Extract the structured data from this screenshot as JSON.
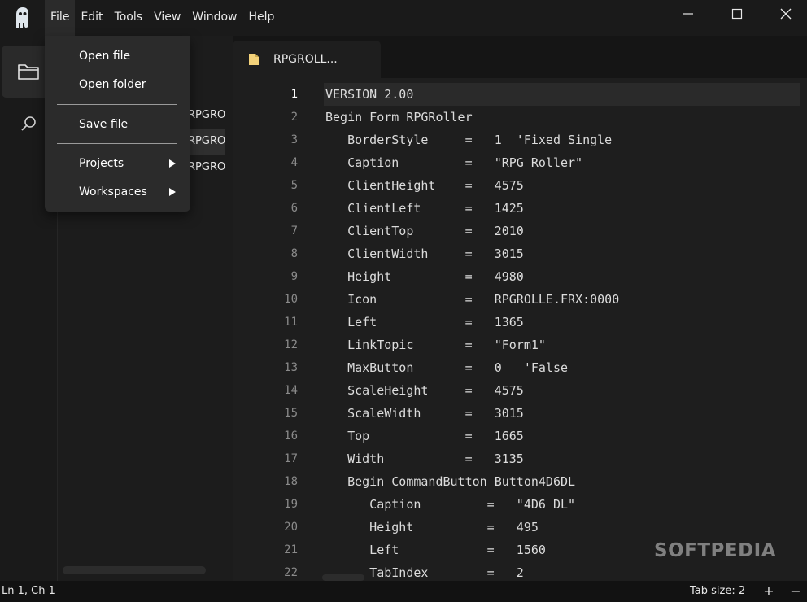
{
  "menubar": {
    "items": [
      {
        "label": "File"
      },
      {
        "label": "Edit"
      },
      {
        "label": "Tools"
      },
      {
        "label": "View"
      },
      {
        "label": "Window"
      },
      {
        "label": "Help"
      }
    ]
  },
  "file_menu": {
    "open_file": "Open file",
    "open_folder": "Open folder",
    "save_file": "Save file",
    "projects": "Projects",
    "workspaces": "Workspaces"
  },
  "explorer": {
    "files": [
      {
        "label": "RPGROLLER.MAK"
      },
      {
        "label": "RPGROLLE.FRM"
      },
      {
        "label": "RPGROLLE.FRX"
      }
    ]
  },
  "editor": {
    "tab_label": "RPGROLL...",
    "lines": [
      {
        "num": "1",
        "text": "VERSION 2.00"
      },
      {
        "num": "2",
        "text": "Begin Form RPGRoller"
      },
      {
        "num": "3",
        "text": "   BorderStyle     =   1  'Fixed Single"
      },
      {
        "num": "4",
        "text": "   Caption         =   \"RPG Roller\""
      },
      {
        "num": "5",
        "text": "   ClientHeight    =   4575"
      },
      {
        "num": "6",
        "text": "   ClientLeft      =   1425"
      },
      {
        "num": "7",
        "text": "   ClientTop       =   2010"
      },
      {
        "num": "8",
        "text": "   ClientWidth     =   3015"
      },
      {
        "num": "9",
        "text": "   Height          =   4980"
      },
      {
        "num": "10",
        "text": "   Icon            =   RPGROLLE.FRX:0000"
      },
      {
        "num": "11",
        "text": "   Left            =   1365"
      },
      {
        "num": "12",
        "text": "   LinkTopic       =   \"Form1\""
      },
      {
        "num": "13",
        "text": "   MaxButton       =   0   'False"
      },
      {
        "num": "14",
        "text": "   ScaleHeight     =   4575"
      },
      {
        "num": "15",
        "text": "   ScaleWidth      =   3015"
      },
      {
        "num": "16",
        "text": "   Top             =   1665"
      },
      {
        "num": "17",
        "text": "   Width           =   3135"
      },
      {
        "num": "18",
        "text": "   Begin CommandButton Button4D6DL"
      },
      {
        "num": "19",
        "text": "      Caption         =   \"4D6 DL\""
      },
      {
        "num": "20",
        "text": "      Height          =   495"
      },
      {
        "num": "21",
        "text": "      Left            =   1560"
      },
      {
        "num": "22",
        "text": "      TabIndex        =   2"
      }
    ]
  },
  "statusbar": {
    "position": "Ln 1, Ch 1",
    "tab_size": "Tab size: 2",
    "increase": "+",
    "decrease": "−"
  },
  "watermark": "SOFTPEDIA",
  "colors": {
    "background": "#141414",
    "editor_bg": "#1e1e1e",
    "menu_bg": "#2b2b2b",
    "tab_icon": "#f3d27a"
  },
  "icons": {
    "app_logo": "ghost-logo-icon",
    "explorer": "folder-icon",
    "search": "search-icon",
    "minimize": "minimize-icon",
    "maximize": "maximize-icon",
    "close": "close-icon",
    "tab_file": "file-icon"
  }
}
